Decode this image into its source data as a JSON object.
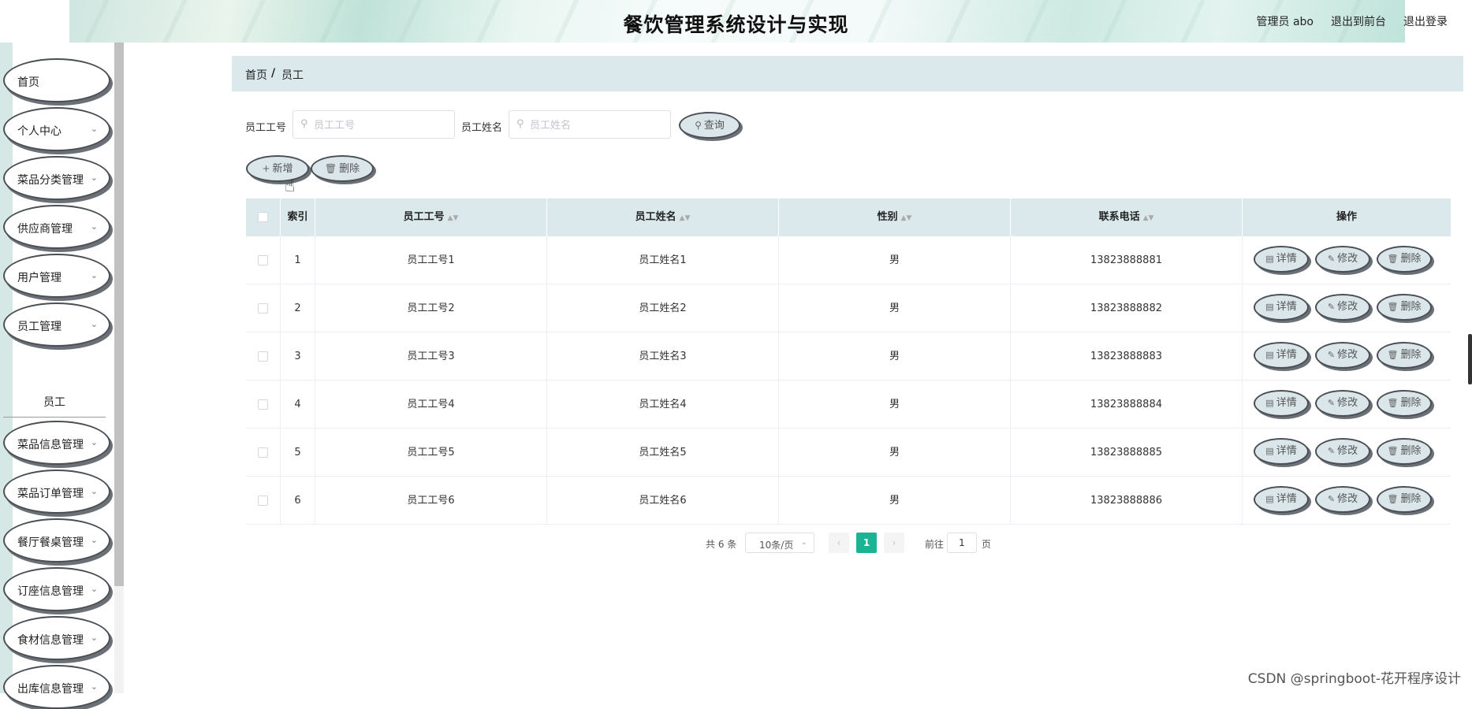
{
  "header": {
    "title": "餐饮管理系统设计与实现",
    "user": "管理员 abo",
    "to_front": "退出到前台",
    "logout": "退出登录"
  },
  "sidebar": {
    "items": [
      {
        "label": "首页",
        "has_chevron": false
      },
      {
        "label": "个人中心",
        "has_chevron": true
      },
      {
        "label": "菜品分类管理",
        "has_chevron": true
      },
      {
        "label": "供应商管理",
        "has_chevron": true
      },
      {
        "label": "用户管理",
        "has_chevron": true
      },
      {
        "label": "员工管理",
        "has_chevron": true
      },
      {
        "label": "菜品信息管理",
        "has_chevron": true
      },
      {
        "label": "菜品订单管理",
        "has_chevron": true
      },
      {
        "label": "餐厅餐桌管理",
        "has_chevron": true
      },
      {
        "label": "订座信息管理",
        "has_chevron": true
      },
      {
        "label": "食材信息管理",
        "has_chevron": true
      },
      {
        "label": "出库信息管理",
        "has_chevron": true
      }
    ],
    "active_sub": "员工"
  },
  "breadcrumb": {
    "home": "首页",
    "sep": "/",
    "current": "员工"
  },
  "search": {
    "emp_no_label": "员工工号",
    "emp_no_placeholder": "员工工号",
    "emp_no_value": "",
    "emp_name_label": "员工姓名",
    "emp_name_placeholder": "员工姓名",
    "emp_name_value": "",
    "query_label": "查询"
  },
  "actions": {
    "add_label": "新增",
    "delete_label": "删除"
  },
  "table": {
    "headers": {
      "index": "索引",
      "emp_no": "员工工号",
      "emp_name": "员工姓名",
      "gender": "性别",
      "phone": "联系电话",
      "ops": "操作"
    },
    "rows": [
      {
        "index": "1",
        "emp_no": "员工工号1",
        "emp_name": "员工姓名1",
        "gender": "男",
        "phone": "13823888881"
      },
      {
        "index": "2",
        "emp_no": "员工工号2",
        "emp_name": "员工姓名2",
        "gender": "男",
        "phone": "13823888882"
      },
      {
        "index": "3",
        "emp_no": "员工工号3",
        "emp_name": "员工姓名3",
        "gender": "男",
        "phone": "13823888883"
      },
      {
        "index": "4",
        "emp_no": "员工工号4",
        "emp_name": "员工姓名4",
        "gender": "男",
        "phone": "13823888884"
      },
      {
        "index": "5",
        "emp_no": "员工工号5",
        "emp_name": "员工姓名5",
        "gender": "男",
        "phone": "13823888885"
      },
      {
        "index": "6",
        "emp_no": "员工工号6",
        "emp_name": "员工姓名6",
        "gender": "男",
        "phone": "13823888886"
      }
    ],
    "row_actions": {
      "detail": "详情",
      "edit": "修改",
      "delete": "删除"
    }
  },
  "pagination": {
    "total": "共 6 条",
    "page_size": "10条/页",
    "current_page": "1",
    "goto_label": "前往",
    "goto_value": "1",
    "page_unit": "页"
  },
  "watermark": "CSDN @springboot-花开程序设计"
}
